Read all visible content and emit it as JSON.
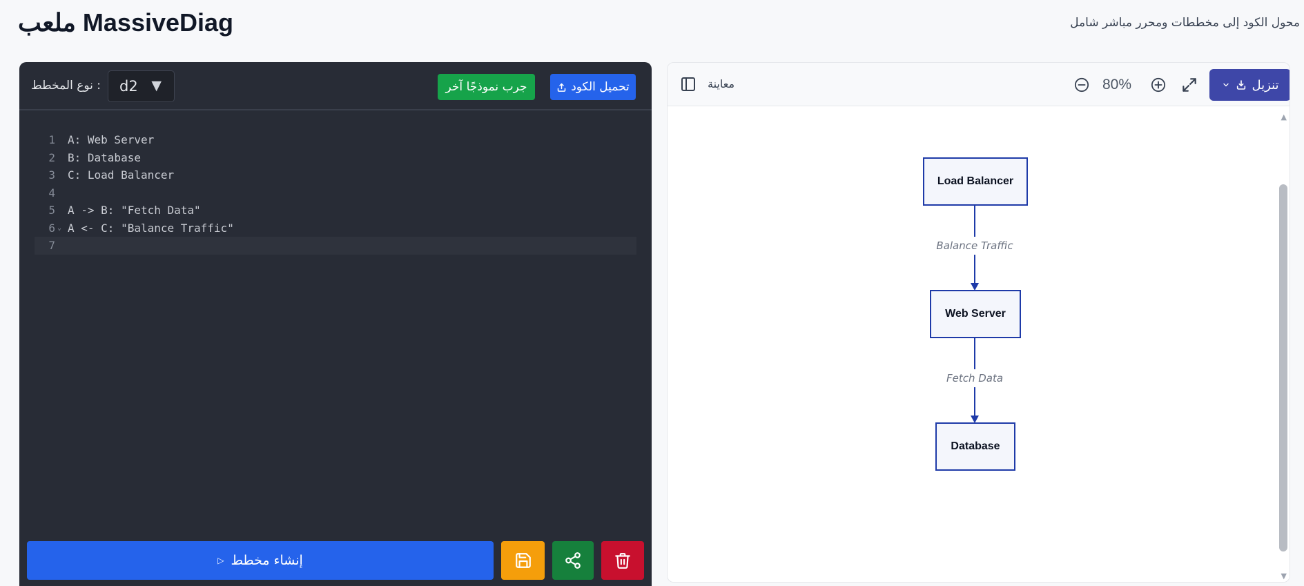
{
  "header": {
    "app_title": "ملعب MassiveDiag",
    "tagline": "محول الكود إلى مخططات ومحرر مباشر شامل"
  },
  "editor": {
    "diagram_type_label": ": نوع المخطط",
    "diagram_type_value": "d2",
    "try_sample_label": "جرب نموذجًا آخر",
    "upload_code_label": "تحميل الكود",
    "code_lines": [
      {
        "num": "1",
        "text": "A: Web Server"
      },
      {
        "num": "2",
        "text": "B: Database"
      },
      {
        "num": "3",
        "text": "C: Load Balancer"
      },
      {
        "num": "4",
        "text": ""
      },
      {
        "num": "5",
        "text": "A -> B: \"Fetch Data\""
      },
      {
        "num": "6",
        "text": "A <- C: \"Balance Traffic\""
      },
      {
        "num": "7",
        "text": ""
      }
    ],
    "generate_label": "إنشاء مخطط"
  },
  "preview": {
    "label": "معاينة",
    "zoom_level": "80%",
    "download_label": "تنزيل"
  },
  "diagram": {
    "nodes": {
      "load_balancer": "Load Balancer",
      "web_server": "Web Server",
      "database": "Database"
    },
    "edges": {
      "balance_traffic": "Balance Traffic",
      "fetch_data": "Fetch Data"
    }
  },
  "colors": {
    "editor_bg": "#282c36",
    "primary_blue": "#2563eb",
    "sample_green": "#16a34a",
    "save_amber": "#f59e0b",
    "share_green": "#16803c",
    "delete_red": "#c8102e",
    "download_indigo": "#3e47a8",
    "diagram_stroke": "#1e3aa8"
  }
}
